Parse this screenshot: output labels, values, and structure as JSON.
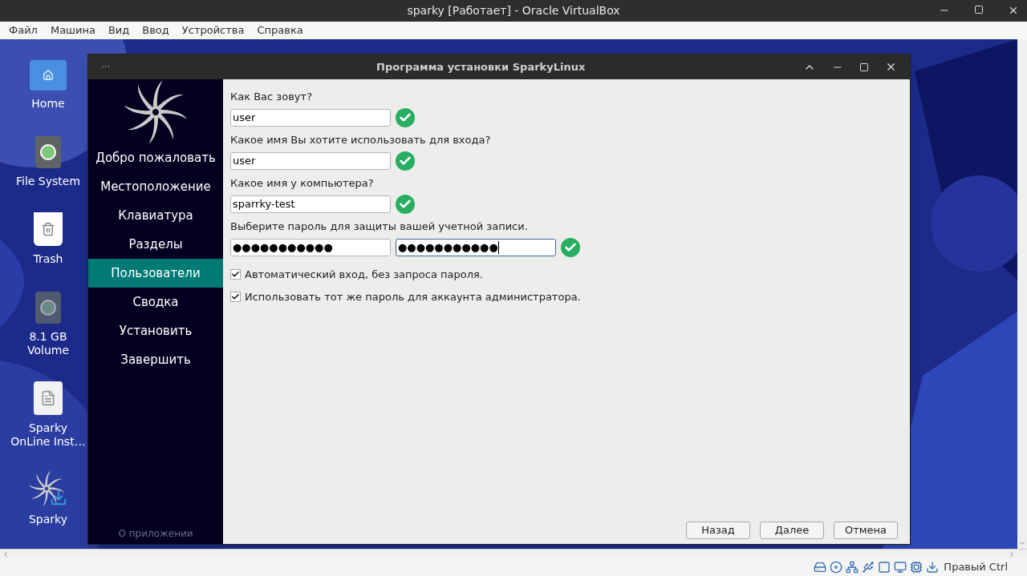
{
  "host_window": {
    "title": "sparky [Работает] - Oracle VirtualBox"
  },
  "menu": [
    "Файл",
    "Машина",
    "Вид",
    "Ввод",
    "Устройства",
    "Справка"
  ],
  "desktop_icons": [
    {
      "kind": "folder",
      "label": "Home"
    },
    {
      "kind": "drive",
      "label": "File System"
    },
    {
      "kind": "trash",
      "label": "Trash"
    },
    {
      "kind": "volume",
      "label": "8.1 GB Volume"
    },
    {
      "kind": "document",
      "label": "Sparky OnLine Inst…"
    },
    {
      "kind": "installer",
      "label": "Sparky"
    }
  ],
  "installer": {
    "title": "Программа установки SparkyLinux",
    "menu_dots": "···",
    "steps": [
      {
        "label": "Добро пожаловать",
        "selected": false
      },
      {
        "label": "Местоположение",
        "selected": false
      },
      {
        "label": "Клавиатура",
        "selected": false
      },
      {
        "label": "Разделы",
        "selected": false
      },
      {
        "label": "Пользователи",
        "selected": true
      },
      {
        "label": "Сводка",
        "selected": false
      },
      {
        "label": "Установить",
        "selected": false
      },
      {
        "label": "Завершить",
        "selected": false
      }
    ],
    "about": "О приложении",
    "questions": [
      {
        "label": "Как Вас зовут?",
        "fields": [
          {
            "value": "user",
            "focused": false
          }
        ],
        "valid": true
      },
      {
        "label": "Какое имя Вы хотите использовать для входа?",
        "fields": [
          {
            "value": "user",
            "focused": false
          }
        ],
        "valid": true
      },
      {
        "label": "Какое имя у компьютера?",
        "fields": [
          {
            "value": "sparrky-test",
            "focused": false
          }
        ],
        "valid": true
      },
      {
        "label": "Выберите пароль для защиты вашей учетной записи.",
        "fields": [
          {
            "value": "●●●●●●●●●●●",
            "focused": false
          },
          {
            "value": "●●●●●●●●●●●",
            "focused": true
          }
        ],
        "valid": true
      }
    ],
    "options": [
      {
        "label": "Автоматический вход, без запроса пароля.",
        "checked": true
      },
      {
        "label": "Использовать тот же пароль для аккаунта администратора.",
        "checked": true
      }
    ],
    "buttons": [
      "Назад",
      "Далее",
      "Отмена"
    ]
  },
  "status_bar": {
    "host_key": "Правый Ctrl"
  }
}
